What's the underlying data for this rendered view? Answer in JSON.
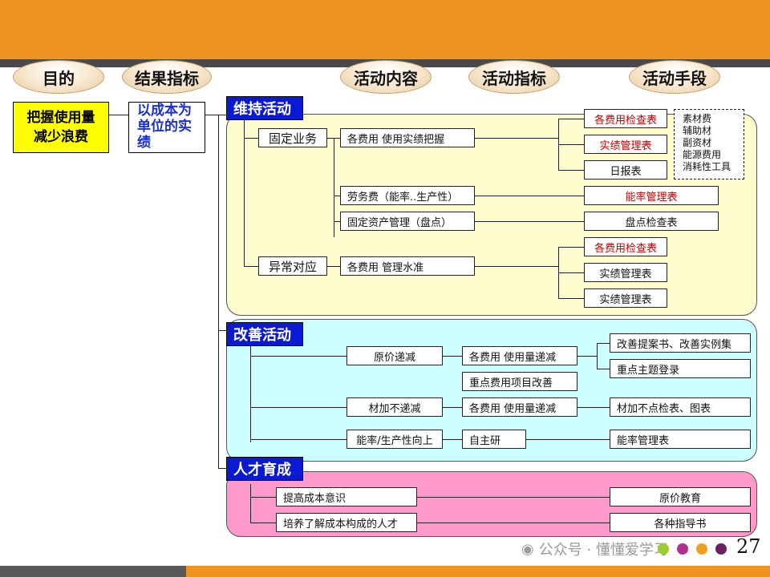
{
  "headers": {
    "purpose": "目的",
    "result_index": "结果指标",
    "activity_content": "活动内容",
    "activity_index": "活动指标",
    "activity_means": "活动手段"
  },
  "purpose_box": "把握使用量减少浪费",
  "result_box": "以成本为单位的实绩",
  "sections": {
    "maintain": "维持活动",
    "improve": "改善活动",
    "talent": "人才育成"
  },
  "maintain": {
    "fixed_business": "固定业务",
    "abnormal": "异常对应",
    "items": {
      "cost_usage": "各费用 使用实绩把握",
      "labor": "劳务费（能率..生产性）",
      "fixed_assets": "固定资产管理（盘点）",
      "cost_mgmt": "各费用 管理水准"
    },
    "tools": {
      "cost_check": "各费用检查表",
      "actual_mgmt": "实绩管理表",
      "daily": "日报表",
      "efficiency": "能率管理表",
      "inventory": "盘点检查表",
      "cost_check2": "各费用检查表",
      "actual_mgmt2": "实绩管理表",
      "actual_mgmt3": "实绩管理表"
    },
    "materials": [
      "素材费",
      "辅助材",
      "副资材",
      "能源费用",
      "消耗性工具"
    ]
  },
  "improve": {
    "cost_reduce": "原价递减",
    "usage_reduce1": "各费用 使用量递减",
    "key_cost": "重点费用项目改善",
    "material_reduce": "材加不递减",
    "usage_reduce2": "各费用 使用量递减",
    "efficiency_up": "能率/生产性向上",
    "self_study": "自主研",
    "proposal": "改善提案书、改善实例集",
    "key_theme": "重点主题登录",
    "material_check": "材加不点检表、图表",
    "efficiency_table": "能率管理表"
  },
  "talent": {
    "awareness": "提高成本意识",
    "cultivate": "培养了解成本构成的人才",
    "cost_edu": "原价教育",
    "guides": "各种指导书"
  },
  "watermark": "公众号 · 懂懂爱学习",
  "page_number": "27"
}
